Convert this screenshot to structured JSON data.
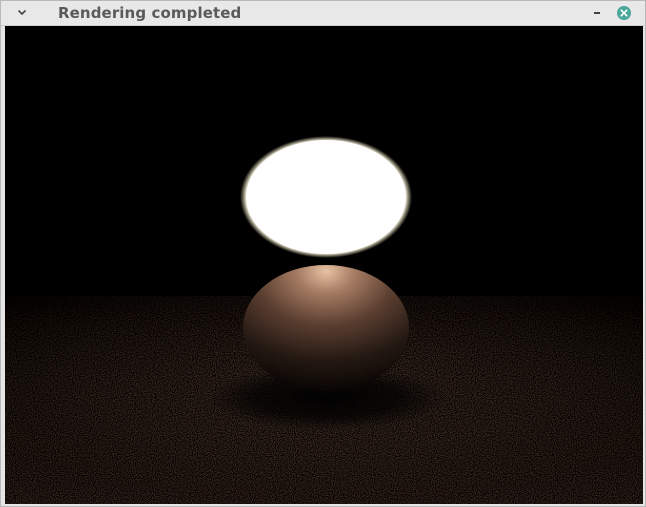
{
  "window": {
    "title": "Rendering completed"
  },
  "icons": {
    "menu": "chevron-down-icon",
    "minimize": "minimize-icon",
    "close": "close-icon"
  },
  "colors": {
    "close_accent": "#4aa79a",
    "titlebar_bg": "#e8e8e8",
    "title_text": "#5a5a5a",
    "floor_tint": "#5a4032",
    "sky": "#000000",
    "light_sphere": "#ffffff"
  }
}
